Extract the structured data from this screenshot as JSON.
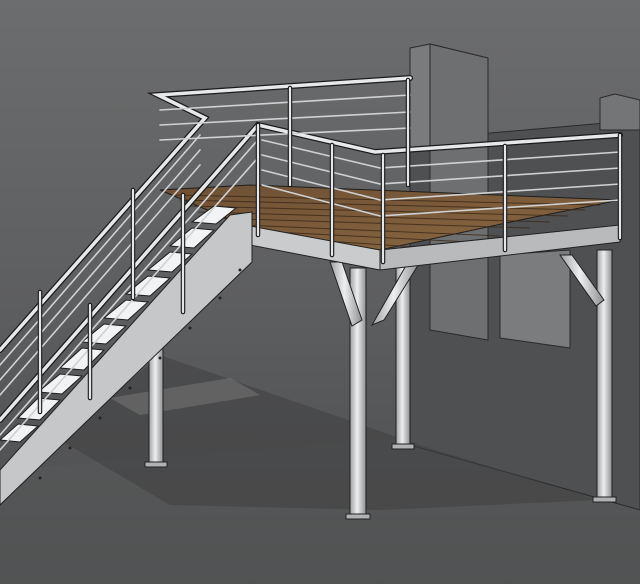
{
  "scene": {
    "subject": "steel-mezzanine-with-staircase",
    "colors": {
      "background_top": "#6a6b6c",
      "background_bottom": "#4a4b4c",
      "floor": "#5a5b5c",
      "wall": "#4f5051",
      "steel": "#d8dadc",
      "steel_dark": "#8a8c8e",
      "steel_shadow": "#6f7173",
      "deck": "#7a5a3a",
      "deck_dark": "#4a3422",
      "outline": "#1a1a1a",
      "shadow": "#3e3f40"
    }
  }
}
